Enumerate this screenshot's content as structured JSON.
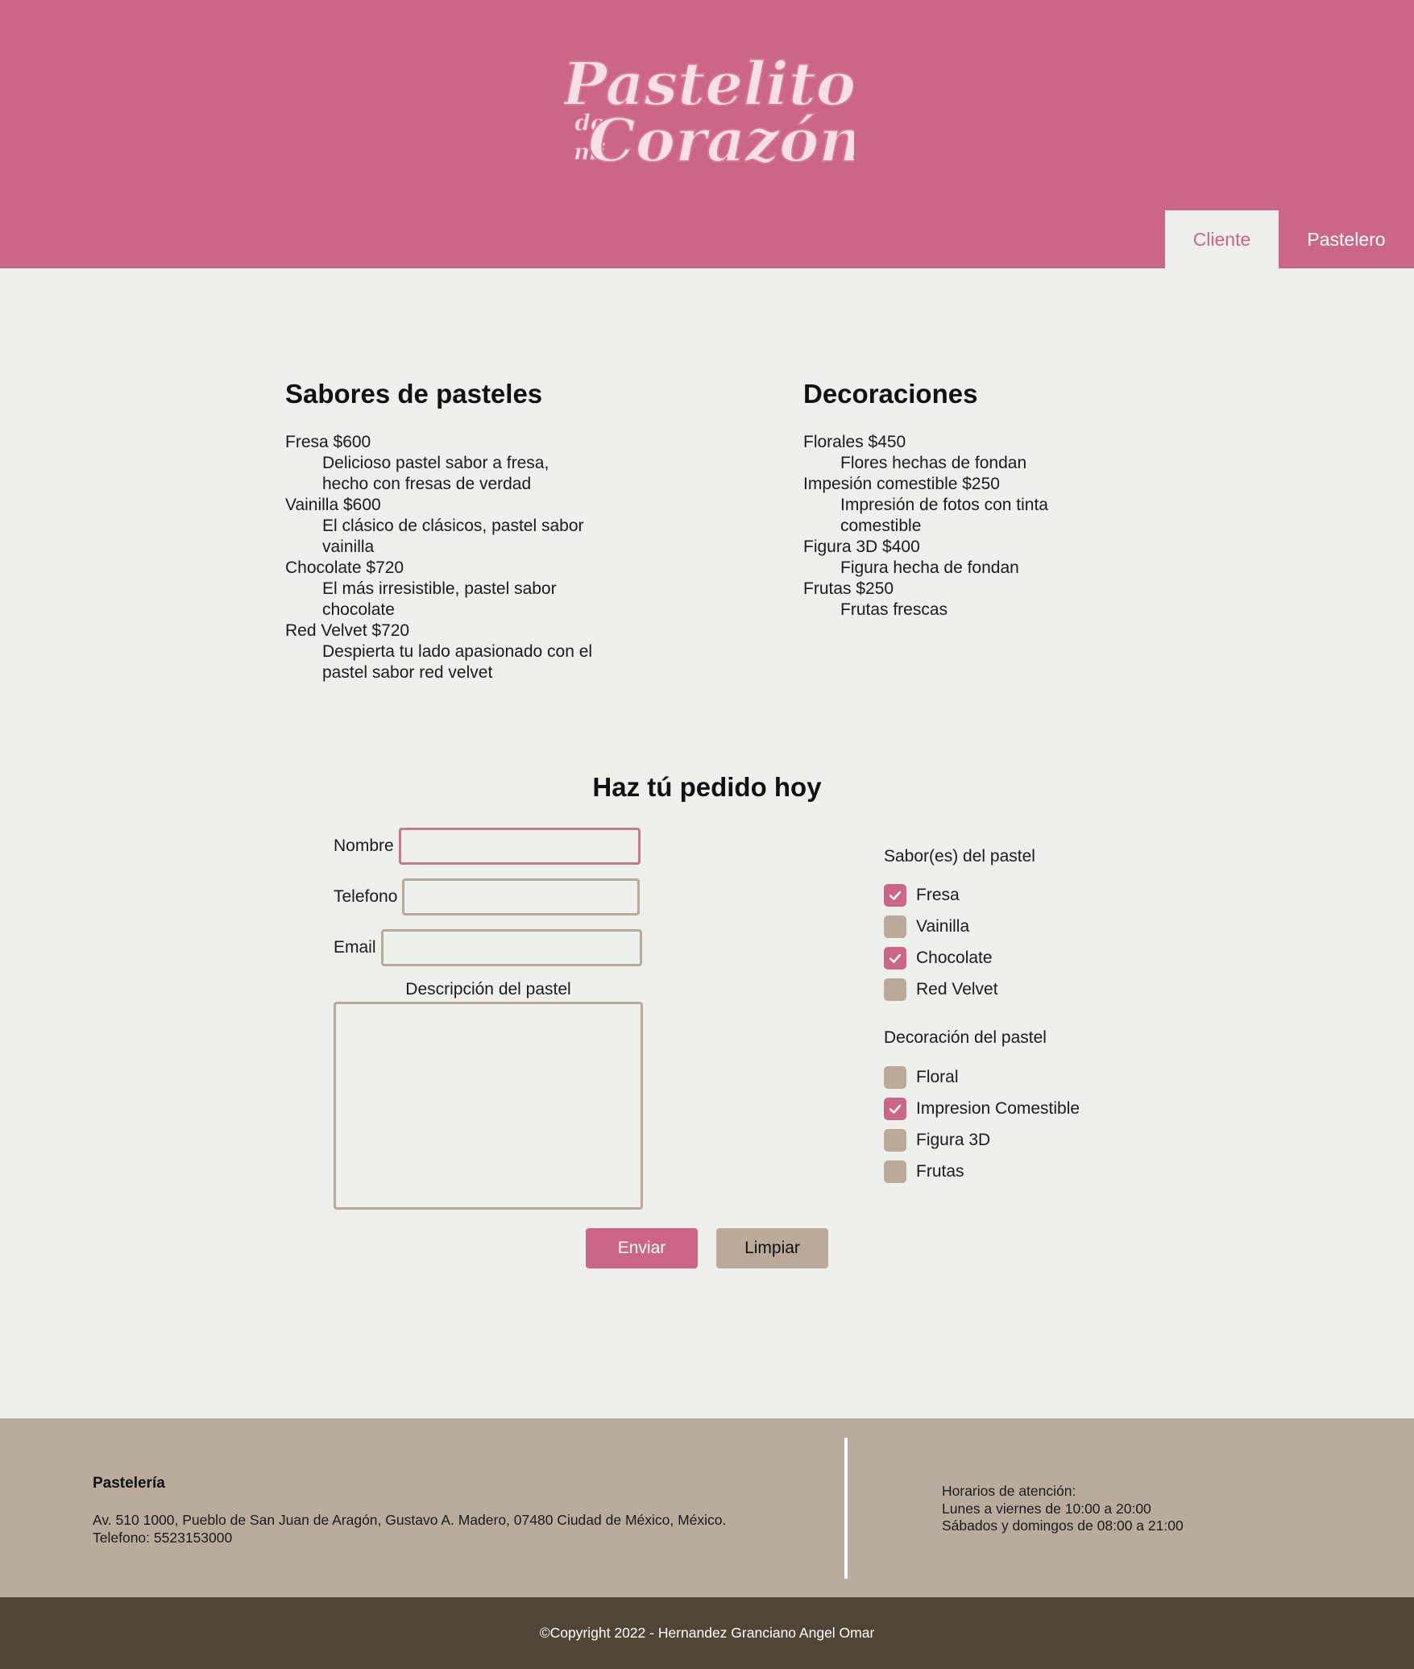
{
  "header": {
    "logo": {
      "line1": "Pastelito",
      "small_de": "de",
      "small_mi": "mi",
      "line2": "Corazón"
    },
    "nav": [
      {
        "label": "Cliente",
        "active": true
      },
      {
        "label": "Pastelero",
        "active": false
      }
    ]
  },
  "flavors": {
    "title": "Sabores de pasteles",
    "items": [
      {
        "name": "Fresa $600",
        "desc": [
          "Delicioso pastel sabor a fresa,",
          "hecho con fresas de verdad"
        ]
      },
      {
        "name": "Vainilla $600",
        "desc": [
          "El clásico de clásicos, pastel sabor",
          "vainilla"
        ]
      },
      {
        "name": "Chocolate $720",
        "desc": [
          "El más irresistible, pastel sabor",
          "chocolate"
        ]
      },
      {
        "name": "Red Velvet $720",
        "desc": [
          "Despierta tu lado apasionado con el",
          "pastel sabor red velvet"
        ]
      }
    ]
  },
  "decorations": {
    "title": "Decoraciones",
    "items": [
      {
        "name": "Florales $450",
        "desc": [
          "Flores hechas de fondan"
        ]
      },
      {
        "name": "Impesión comestible $250",
        "desc": [
          "Impresión de fotos con tinta",
          "comestible"
        ]
      },
      {
        "name": "Figura 3D $400",
        "desc": [
          "Figura hecha de fondan"
        ]
      },
      {
        "name": "Frutas $250",
        "desc": [
          "Frutas frescas"
        ]
      }
    ]
  },
  "order": {
    "title": "Haz tú pedido hoy",
    "name_label": "Nombre",
    "name_value": "",
    "phone_label": "Telefono",
    "phone_value": "",
    "email_label": "Email",
    "email_value": "",
    "desc_label": "Descripción del pastel",
    "desc_value": "",
    "flavor_group": {
      "title": "Sabor(es) del pastel",
      "options": [
        {
          "label": "Fresa",
          "checked": true
        },
        {
          "label": "Vainilla",
          "checked": false
        },
        {
          "label": "Chocolate",
          "checked": true
        },
        {
          "label": "Red Velvet",
          "checked": false
        }
      ]
    },
    "decor_group": {
      "title": "Decoración del pastel",
      "options": [
        {
          "label": "Floral",
          "checked": false
        },
        {
          "label": "Impresion Comestible",
          "checked": true
        },
        {
          "label": "Figura 3D",
          "checked": false
        },
        {
          "label": "Frutas",
          "checked": false
        }
      ]
    },
    "send_label": "Enviar",
    "clear_label": "Limpiar"
  },
  "footer": {
    "title": "Pastelería",
    "address": "Av. 510 1000, Pueblo de San Juan de Aragón, Gustavo A. Madero, 07480 Ciudad de México, México. Telefono: 5523153000",
    "hours": [
      "Horarios de atención:",
      "Lunes a viernes de 10:00 a 20:00",
      "Sábados y domingos de 08:00 a 21:00"
    ],
    "copyright": "©Copyright 2022 - Hernandez Granciano Angel Omar"
  },
  "colors": {
    "brand_pink": "#cb6686",
    "page_bg": "#edf0eb",
    "tan": "#baac9c",
    "dark_brown": "#514536"
  }
}
